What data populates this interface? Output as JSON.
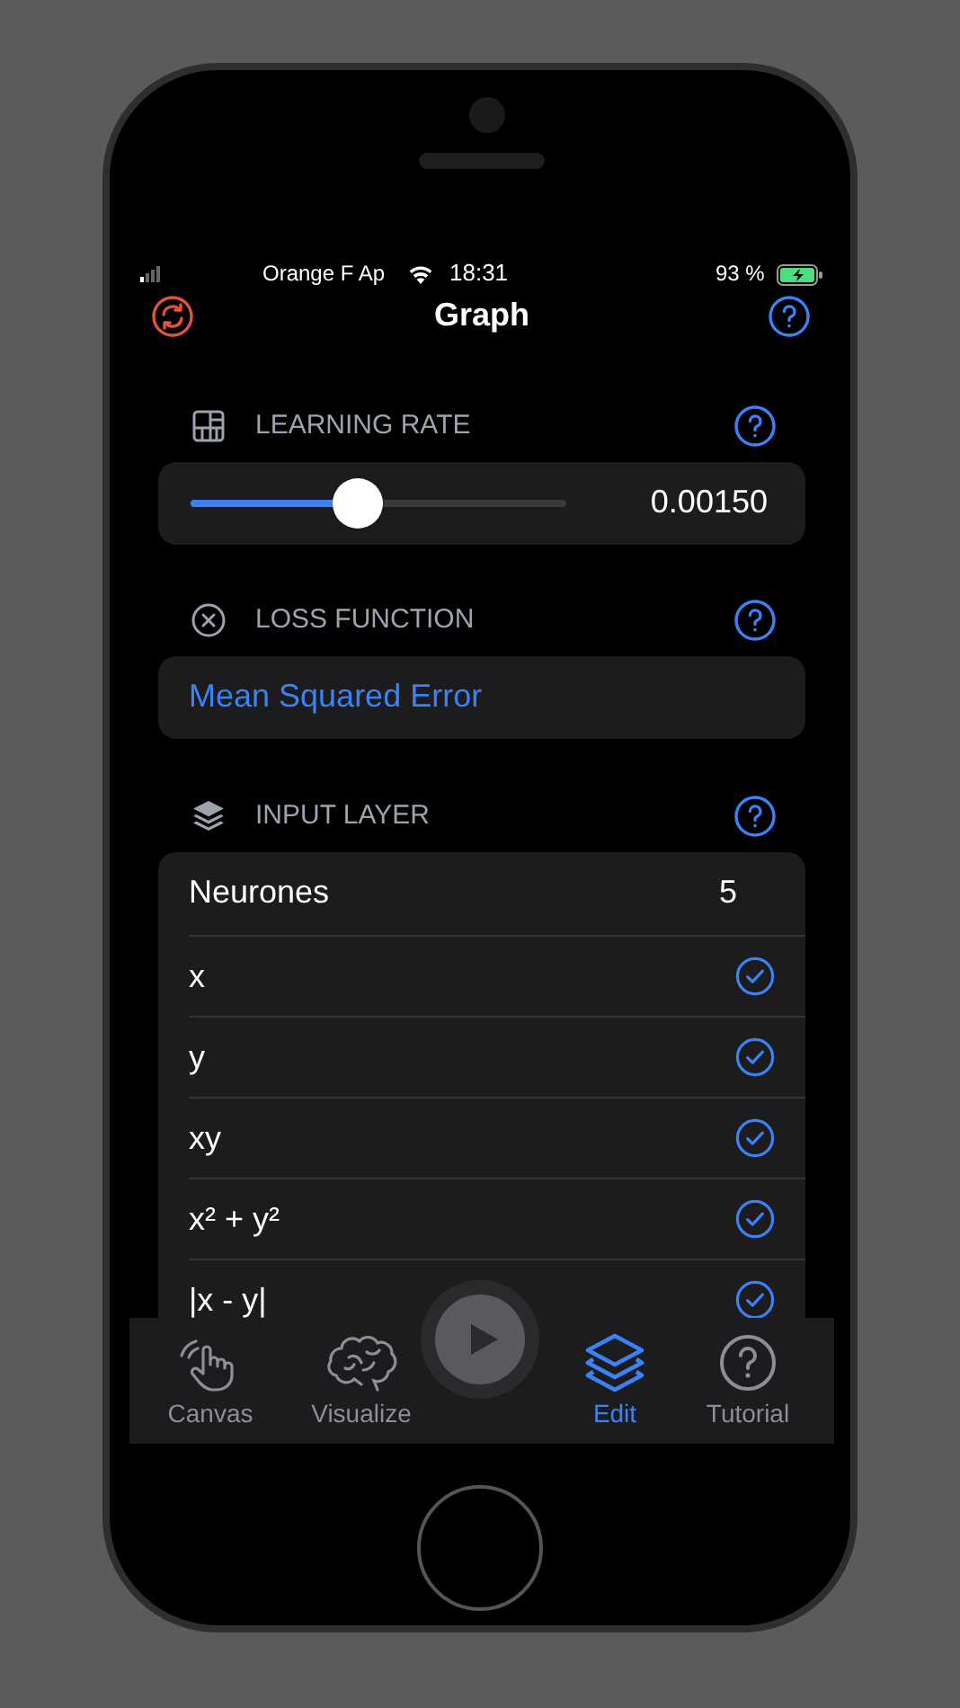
{
  "status_bar": {
    "carrier": "Orange F Ap",
    "time": "18:31",
    "battery": "93 %"
  },
  "nav": {
    "title": "Graph"
  },
  "sections": [
    {
      "kind": "slider",
      "title": "LEARNING RATE",
      "level": 0.445,
      "reading": "0.00150"
    },
    {
      "kind": "choice",
      "title": "LOSS FUNCTION",
      "value": "Mean Squared Error"
    },
    {
      "kind": "inputs",
      "title": "INPUT LAYER",
      "count_label": "Neurones",
      "count": "5",
      "rows": [
        {
          "label": "x",
          "checked": true
        },
        {
          "label": "y",
          "checked": true
        },
        {
          "label": "xy",
          "checked": true
        },
        {
          "label": "x² + y²",
          "checked": true
        },
        {
          "label": "|x - y|",
          "checked": true
        }
      ]
    }
  ],
  "tabs": [
    {
      "label": "Canvas",
      "kind": "hand",
      "selected": false
    },
    {
      "label": "Visualize",
      "kind": "brain",
      "selected": false
    },
    {
      "label": "Edit",
      "kind": "layers",
      "selected": true
    },
    {
      "label": "Tutorial",
      "kind": "help",
      "selected": false
    }
  ]
}
